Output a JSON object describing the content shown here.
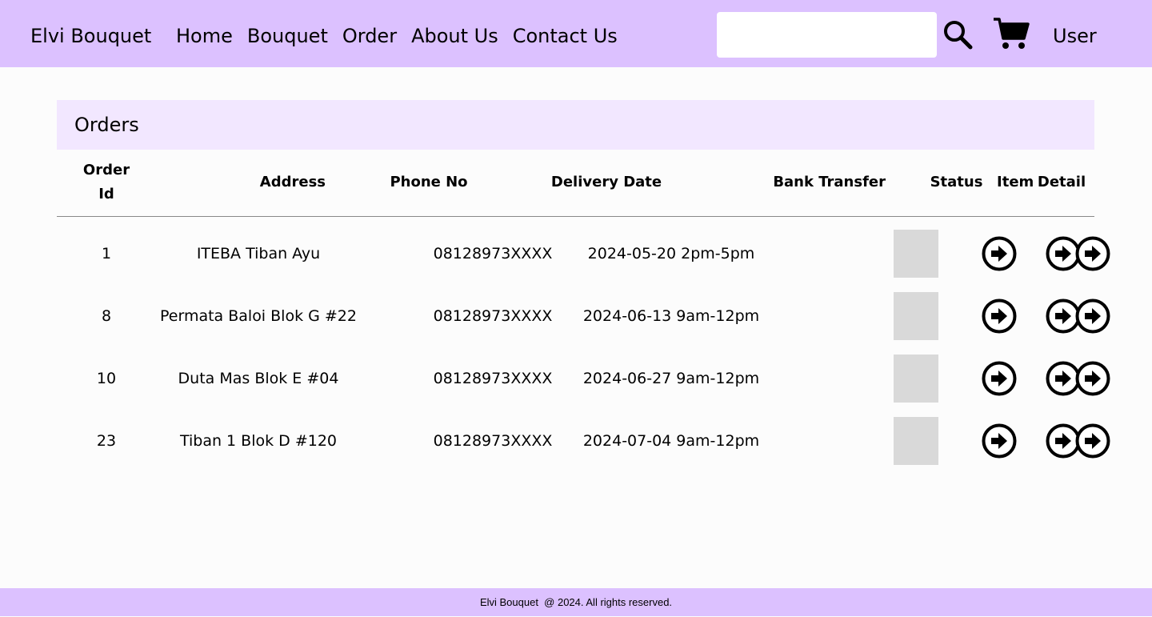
{
  "header": {
    "brand": "Elvi Bouquet",
    "nav": [
      "Home",
      "Bouquet",
      "Order",
      "About Us",
      "Contact Us"
    ],
    "search": {
      "value": "",
      "placeholder": ""
    },
    "search_icon": "search-icon",
    "cart_icon": "cart-icon",
    "user_label": "User"
  },
  "orders": {
    "title": "Orders",
    "columns": {
      "order_id_line1": "Order",
      "order_id_line2": "Id",
      "address": "Address",
      "phone": "Phone No",
      "delivery_date": "Delivery Date",
      "bank_transfer": "Bank Transfer",
      "status": "Status",
      "item": "Item",
      "detail": "Detail"
    },
    "rows": [
      {
        "id": "1",
        "address": "ITEBA Tiban Ayu",
        "phone": "08128973XXXX",
        "delivery": "2024-05-20 2pm-5pm"
      },
      {
        "id": "8",
        "address": "Permata Baloi Blok G #22",
        "phone": "08128973XXXX",
        "delivery": "2024-06-13 9am-12pm"
      },
      {
        "id": "10",
        "address": "Duta Mas Blok E #04",
        "phone": "08128973XXXX",
        "delivery": "2024-06-27 9am-12pm"
      },
      {
        "id": "23",
        "address": "Tiban 1 Blok D #120",
        "phone": "08128973XXXX",
        "delivery": "2024-07-04 9am-12pm"
      }
    ],
    "row_action_icon": "arrow-circle-right-icon",
    "transfer_placeholder_color": "#d9d9d9"
  },
  "colors": {
    "header_bg": "#dcc1ff",
    "panel_header_bg": "#f2e7ff",
    "page_bg": "#fcfcfc"
  },
  "footer": {
    "text": "Elvi Bouquet  @ 2024. All rights reserved."
  }
}
